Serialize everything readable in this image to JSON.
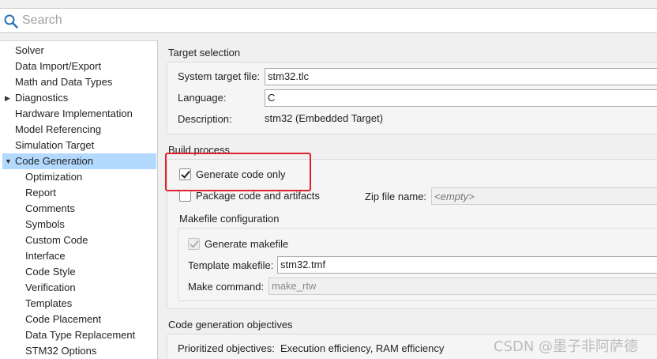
{
  "search": {
    "placeholder": "Search",
    "value": ""
  },
  "tree": {
    "items": [
      {
        "label": "Solver"
      },
      {
        "label": "Data Import/Export"
      },
      {
        "label": "Math and Data Types"
      },
      {
        "label": "Diagnostics",
        "expander": "▶"
      },
      {
        "label": "Hardware Implementation"
      },
      {
        "label": "Model Referencing"
      },
      {
        "label": "Simulation Target"
      },
      {
        "label": "Code Generation",
        "expander": "▼"
      },
      {
        "label": "Optimization"
      },
      {
        "label": "Report"
      },
      {
        "label": "Comments"
      },
      {
        "label": "Symbols"
      },
      {
        "label": "Custom Code"
      },
      {
        "label": "Interface"
      },
      {
        "label": "Code Style"
      },
      {
        "label": "Verification"
      },
      {
        "label": "Templates"
      },
      {
        "label": "Code Placement"
      },
      {
        "label": "Data Type Replacement"
      },
      {
        "label": "STM32 Options"
      }
    ],
    "selected": "Code Generation"
  },
  "target_selection": {
    "title": "Target selection",
    "system_target_file_label": "System target file:",
    "system_target_file_value": "stm32.tlc",
    "language_label": "Language:",
    "language_value": "C",
    "description_label": "Description:",
    "description_value": "stm32 (Embedded Target)"
  },
  "build_process": {
    "title": "Build process",
    "generate_code_only_label": "Generate code only",
    "generate_code_only_checked": true,
    "package_label": "Package code and artifacts",
    "package_checked": false,
    "zip_label": "Zip file name:",
    "zip_placeholder": "<empty>",
    "makefile_config_title": "Makefile configuration",
    "generate_makefile_label": "Generate makefile",
    "generate_makefile_checked": true,
    "template_makefile_label": "Template makefile:",
    "template_makefile_value": "stm32.tmf",
    "make_command_label": "Make command:",
    "make_command_value": "make_rtw"
  },
  "objectives": {
    "title": "Code generation objectives",
    "prioritized_label": "Prioritized objectives:",
    "prioritized_value": "Execution efficiency, RAM efficiency"
  },
  "watermark": "CSDN @墨子非阿萨德",
  "colors": {
    "selection": "#b3d9ff",
    "highlight": "#e0202a",
    "search_icon": "#2a6fb5"
  }
}
